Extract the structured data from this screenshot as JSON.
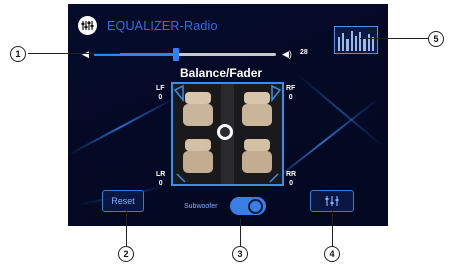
{
  "screen": {
    "title": "EQUALIZER-Radio",
    "balance_fader_title": "Balance/Fader",
    "volume": {
      "value": "28",
      "fraction": 0.45
    },
    "corners": {
      "lf_label": "LF",
      "lf_value": "0",
      "rf_label": "RF",
      "rf_value": "0",
      "lr_label": "LR",
      "lr_value": "0",
      "rr_label": "RR",
      "rr_value": "0"
    },
    "reset_label": "Reset",
    "subwoofer_label": "Subwoofer",
    "subwoofer_on": true
  },
  "callouts": [
    "1",
    "2",
    "3",
    "4",
    "5"
  ],
  "colors": {
    "accent": "#2f82ff",
    "title": "#2f6fe8",
    "background": "#050c2c"
  },
  "icons": [
    "equalizer-icon",
    "speaker-left-icon",
    "speaker-right-icon",
    "equalizer-sliders-icon"
  ]
}
